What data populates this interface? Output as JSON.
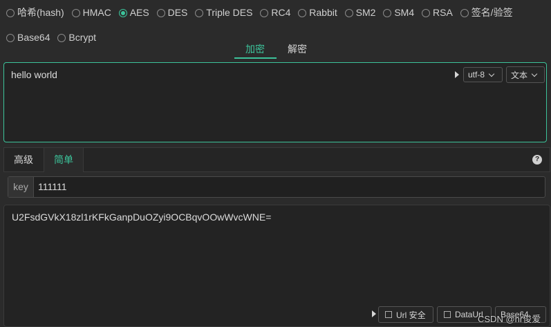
{
  "algorithms": [
    {
      "label": "哈希(hash)",
      "checked": false
    },
    {
      "label": "HMAC",
      "checked": false
    },
    {
      "label": "AES",
      "checked": true
    },
    {
      "label": "DES",
      "checked": false
    },
    {
      "label": "Triple DES",
      "checked": false
    },
    {
      "label": "RC4",
      "checked": false
    },
    {
      "label": "Rabbit",
      "checked": false
    },
    {
      "label": "SM2",
      "checked": false
    },
    {
      "label": "SM4",
      "checked": false
    },
    {
      "label": "RSA",
      "checked": false
    },
    {
      "label": "签名/验签",
      "checked": false
    },
    {
      "label": "Base64",
      "checked": false
    },
    {
      "label": "Bcrypt",
      "checked": false
    }
  ],
  "mode_tabs": {
    "encrypt": "加密",
    "decrypt": "解密",
    "active": "encrypt"
  },
  "input": {
    "text": "hello world",
    "encoding": "utf-8",
    "format": "文本"
  },
  "option_tabs": {
    "advanced": "高级",
    "simple": "简单",
    "active": "simple",
    "help": "?"
  },
  "key": {
    "label": "key",
    "value": "111111"
  },
  "output": {
    "text": "U2FsdGVkX18zl1rKFkGanpDuOZyi9OCBqvOOwWvcWNE=",
    "url_safe_label": "Url 安全",
    "data_url_label": "DataUrl",
    "format_label": "Base64"
  },
  "watermark": "CSDN @hr俊爱",
  "colors": {
    "accent": "#3cc49b",
    "background": "#2b2b2b"
  }
}
